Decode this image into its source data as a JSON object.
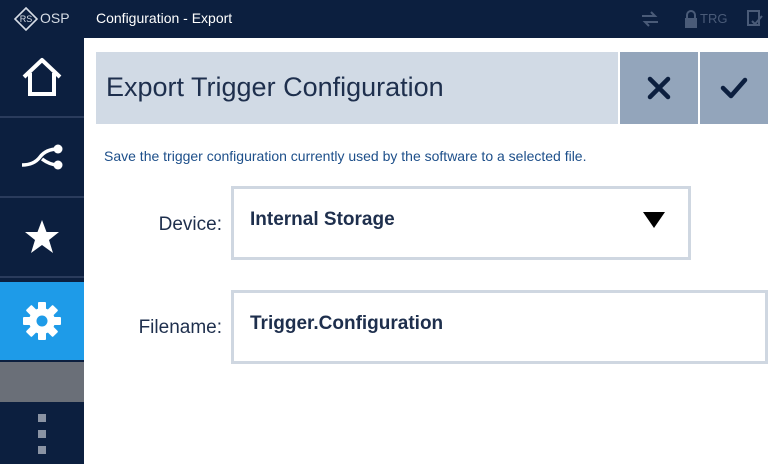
{
  "topbar": {
    "logo_text": "OSP",
    "title": "Configuration - Export",
    "trg_label": "TRG"
  },
  "sidebar": {
    "items": [
      {
        "name": "home-icon"
      },
      {
        "name": "connection-icon"
      },
      {
        "name": "star-icon"
      },
      {
        "name": "gear-icon",
        "active": true
      },
      {
        "name": "more-vertical-icon"
      }
    ]
  },
  "header": {
    "title": "Export Trigger Configuration",
    "cancel_icon": "close-icon",
    "confirm_icon": "checkmark-icon"
  },
  "form": {
    "description": "Save the trigger configuration currently used by the software to a selected file.",
    "device_label": "Device:",
    "device_value": "Internal Storage",
    "filename_label": "Filename:",
    "filename_value": "Trigger.Configuration"
  },
  "colors": {
    "navy": "#0c1f3f",
    "accent": "#1e9be8",
    "header_bg": "#d1dae5",
    "header_button_bg": "#93a5bb",
    "text": "#1e2f4d",
    "description": "#1d4f8a"
  }
}
